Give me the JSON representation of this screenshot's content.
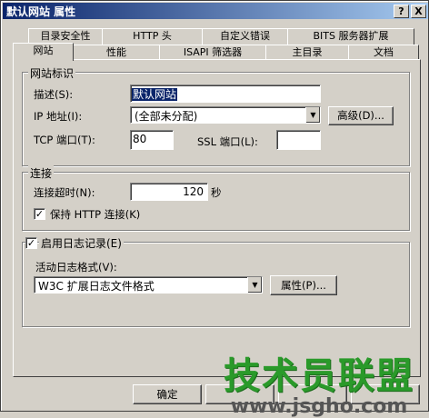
{
  "window": {
    "title": "默认网站 属性",
    "help_btn": "?",
    "close_btn": "X"
  },
  "tabs_back": [
    "目录安全性",
    "HTTP 头",
    "自定义错误",
    "BITS 服务器扩展"
  ],
  "tabs_front": [
    "网站",
    "性能",
    "ISAPI 筛选器",
    "主目录",
    "文档"
  ],
  "website_id": {
    "legend": "网站标识",
    "desc_label": "描述(S):",
    "desc_value": "默认网站",
    "ip_label": "IP 地址(I):",
    "ip_value": "(全部未分配)",
    "advanced_btn": "高级(D)...",
    "tcp_label": "TCP 端口(T):",
    "tcp_value": "80",
    "ssl_label": "SSL 端口(L):",
    "ssl_value": ""
  },
  "connection": {
    "legend": "连接",
    "timeout_label": "连接超时(N):",
    "timeout_value": "120",
    "timeout_unit": "秒",
    "keepalive_label": "保持 HTTP 连接(K)",
    "keepalive_checked": true
  },
  "logging": {
    "enable_label": "启用日志记录(E)",
    "enable_checked": true,
    "format_label": "活动日志格式(V):",
    "format_value": "W3C 扩展日志文件格式",
    "properties_btn": "属性(P)..."
  },
  "footer": {
    "ok_btn": "确定"
  },
  "watermark": {
    "text": "技术员联盟",
    "url": "www.jsgho.com"
  }
}
